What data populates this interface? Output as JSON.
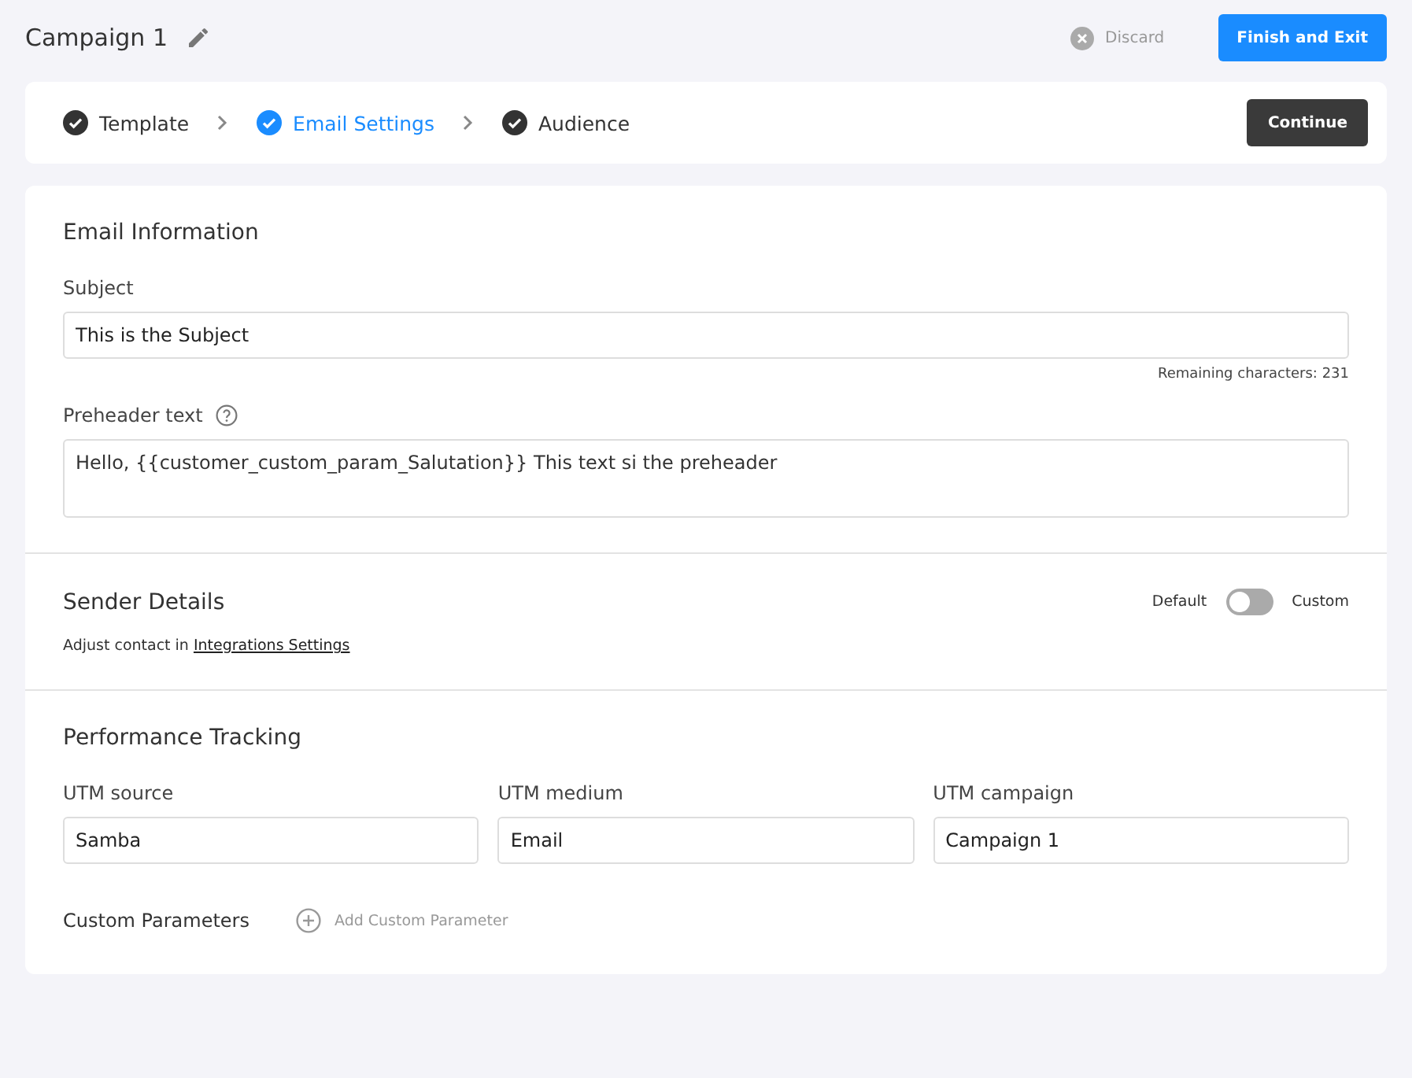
{
  "header": {
    "title": "Campaign 1",
    "discard": "Discard",
    "finish": "Finish and Exit"
  },
  "steps": [
    {
      "label": "Template",
      "selected": false
    },
    {
      "label": "Email Settings",
      "selected": true
    },
    {
      "label": "Audience",
      "selected": false
    }
  ],
  "continue": "Continue",
  "email_information": {
    "heading": "Email Information",
    "subject_label": "Subject",
    "subject_value": "This is the Subject",
    "remaining": "Remaining characters: 231",
    "preheader_label": "Preheader text",
    "preheader_value": "Hello, {{customer_custom_param_Salutation}} This text si the preheader"
  },
  "sender_details": {
    "heading": "Sender Details",
    "default_label": "Default",
    "custom_label": "Custom",
    "custom_on": false,
    "note": "Adjust contact in ",
    "link": "Integrations Settings"
  },
  "performance_tracking": {
    "heading": "Performance Tracking",
    "fields": [
      {
        "label": "UTM source",
        "value": "Samba"
      },
      {
        "label": "UTM medium",
        "value": "Email"
      },
      {
        "label": "UTM campaign",
        "value": "Campaign 1"
      }
    ],
    "custom_parameters_label": "Custom Parameters",
    "add_parameter": "Add Custom Parameter"
  }
}
